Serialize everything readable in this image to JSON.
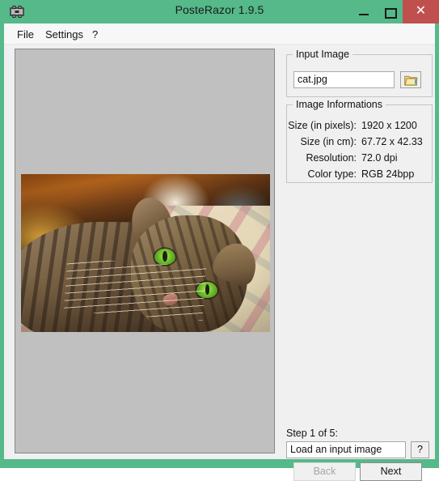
{
  "window": {
    "title": "PosteRazor 1.9.5",
    "icon": "app-icon",
    "accent_green": "#55b98a",
    "close_red": "#c0504d",
    "client_bg": "#f0f0f0",
    "controls": {
      "minimize": "–",
      "maximize": "□",
      "close": "✕"
    }
  },
  "menubar": {
    "items": [
      {
        "label": "File"
      },
      {
        "label": "Settings"
      },
      {
        "label": "?"
      }
    ]
  },
  "preview": {
    "panel_bg": "#c0c0c0",
    "image_alt": "tabby cat lying on a striped blanket with green eyes"
  },
  "input_image": {
    "group_title": "Input Image",
    "filename": "cat.jpg",
    "filename_placeholder": "",
    "browse_icon": "folder-icon"
  },
  "image_informations": {
    "group_title": "Image Informations",
    "rows": [
      {
        "label": "Size (in pixels):",
        "value": "1920 x 1200"
      },
      {
        "label": "Size (in cm):",
        "value": "67.72 x 42.33"
      },
      {
        "label": "Resolution:",
        "value": "72.0 dpi"
      },
      {
        "label": "Color type:",
        "value": "RGB 24bpp"
      }
    ]
  },
  "wizard": {
    "step_label": "Step 1 of 5:",
    "step_description": "Load an input image",
    "help_label": "?",
    "back_label": "Back",
    "next_label": "Next"
  }
}
